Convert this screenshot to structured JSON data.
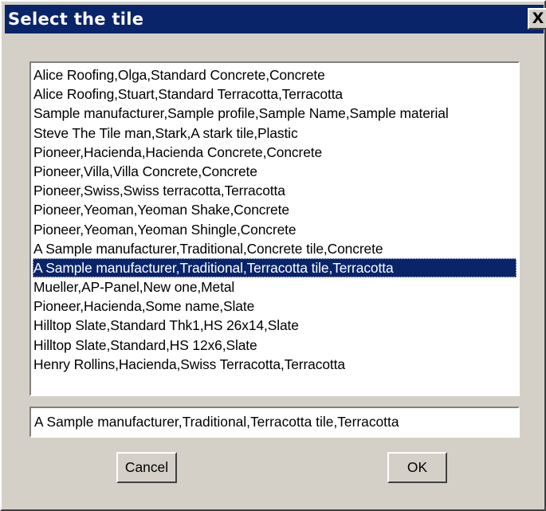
{
  "dialog": {
    "title": "Select the tile",
    "close_label": "X"
  },
  "tile_list": {
    "items": [
      "Alice Roofing,Olga,Standard Concrete,Concrete",
      "Alice Roofing,Stuart,Standard Terracotta,Terracotta",
      "Sample manufacturer,Sample profile,Sample Name,Sample material",
      "Steve The Tile man,Stark,A stark tile,Plastic",
      "Pioneer,Hacienda,Hacienda Concrete,Concrete",
      "Pioneer,Villa,Villa Concrete,Concrete",
      "Pioneer,Swiss,Swiss terracotta,Terracotta",
      "Pioneer,Yeoman,Yeoman Shake,Concrete",
      "Pioneer,Yeoman,Yeoman Shingle,Concrete",
      "A Sample manufacturer,Traditional,Concrete tile,Concrete",
      "A Sample manufacturer,Traditional,Terracotta tile,Terracotta",
      "Mueller,AP-Panel,New one,Metal",
      "Pioneer,Hacienda,Some name,Slate",
      "Hilltop Slate,Standard Thk1,HS 26x14,Slate",
      "Hilltop Slate,Standard,HS 12x6,Slate",
      "Henry Rollins,Hacienda,Swiss Terracotta,Terracotta"
    ],
    "selected_index": 10
  },
  "selection_field": {
    "value": "A Sample manufacturer,Traditional,Terracotta tile,Terracotta"
  },
  "buttons": {
    "cancel_label": "Cancel",
    "ok_label": "OK"
  },
  "colors": {
    "title_bar": "#0a246a",
    "selection_highlight": "#0a246a",
    "dialog_face": "#d4d0c8"
  }
}
